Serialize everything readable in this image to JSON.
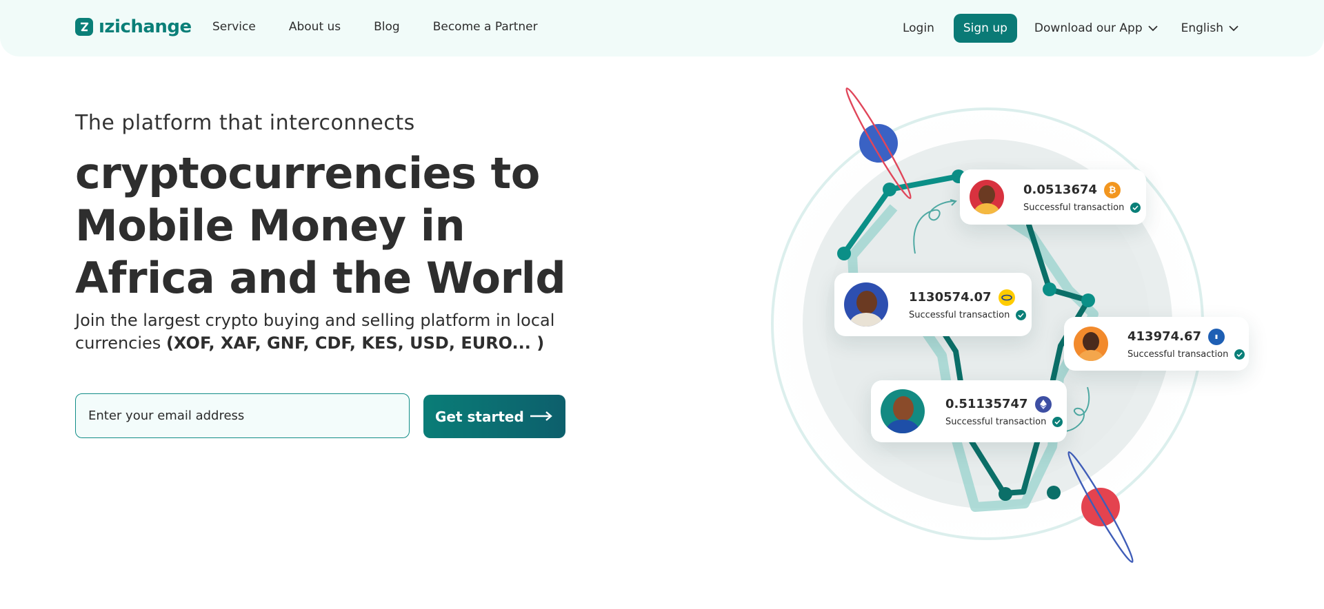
{
  "brand": {
    "name": "ızichange",
    "color": "#0a7f78"
  },
  "nav": {
    "links": [
      "Service",
      "About us",
      "Blog",
      "Become a Partner"
    ],
    "login": "Login",
    "signup": "Sign up",
    "download": "Download our App",
    "language": "English"
  },
  "hero": {
    "subtitle": "The platform that interconnects",
    "title_line1": "cryptocurrencies to",
    "title_line2": "Mobile Money in",
    "title_line3": "Africa and the World",
    "desc_plain": "Join the largest crypto buying and selling platform in local currencies ",
    "desc_bold": "(XOF, XAF, GNF, CDF, KES, USD, EURO... )",
    "email_placeholder": "Enter your email address",
    "cta": "Get started"
  },
  "transactions": [
    {
      "amount": "0.0513674",
      "status": "Successful transaction",
      "coin": "bitcoin-icon",
      "coin_color": "#f2961f"
    },
    {
      "amount": "1130574.07",
      "status": "Successful transaction",
      "coin": "mtn-icon",
      "coin_color": "#ffcc00"
    },
    {
      "amount": "413974.67",
      "status": "Successful transaction",
      "coin": "bank-icon",
      "coin_color": "#1e5fb4"
    },
    {
      "amount": "0.51135747",
      "status": "Successful transaction",
      "coin": "ethereum-icon",
      "coin_color": "#3d4fa3"
    }
  ]
}
